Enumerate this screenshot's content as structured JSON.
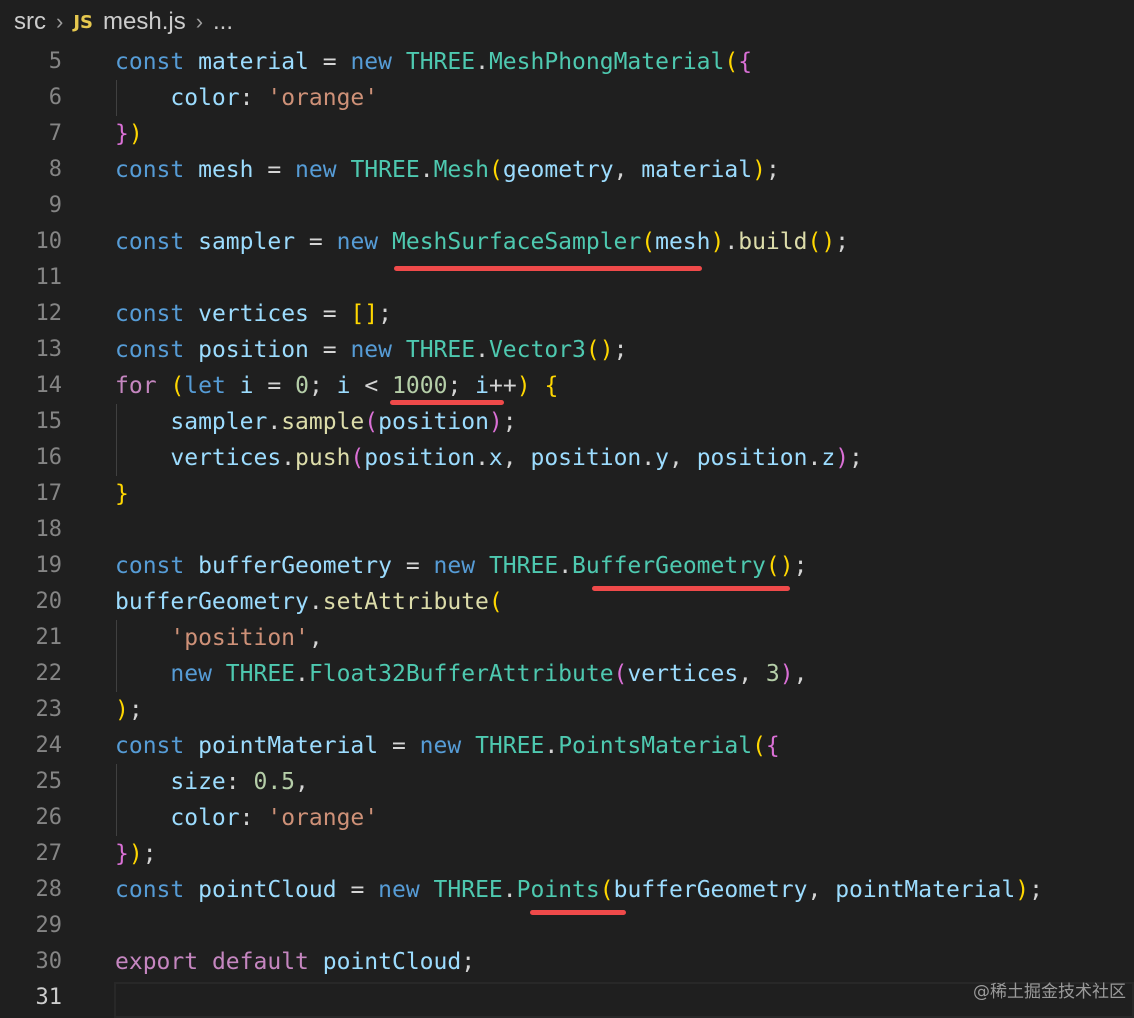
{
  "breadcrumb": {
    "folder": "src",
    "file_icon": "JS",
    "file": "mesh.js",
    "ellipsis": "..."
  },
  "colors": {
    "background": "#1f1f1f",
    "keyword": "#569cd6",
    "class": "#4ec9b0",
    "variable": "#9cdcfe",
    "string": "#ce9178",
    "number": "#b5cea8",
    "underline": "#ef4a4a"
  },
  "code": {
    "lines": [
      {
        "n": "5"
      },
      {
        "n": "6"
      },
      {
        "n": "7"
      },
      {
        "n": "8"
      },
      {
        "n": "9"
      },
      {
        "n": "10"
      },
      {
        "n": "11"
      },
      {
        "n": "12"
      },
      {
        "n": "13"
      },
      {
        "n": "14"
      },
      {
        "n": "15"
      },
      {
        "n": "16"
      },
      {
        "n": "17"
      },
      {
        "n": "18"
      },
      {
        "n": "19"
      },
      {
        "n": "20"
      },
      {
        "n": "21"
      },
      {
        "n": "22"
      },
      {
        "n": "23"
      },
      {
        "n": "24"
      },
      {
        "n": "25"
      },
      {
        "n": "26"
      },
      {
        "n": "27"
      },
      {
        "n": "28"
      },
      {
        "n": "29"
      },
      {
        "n": "30"
      },
      {
        "n": "31"
      }
    ],
    "tokens": {
      "const": "const",
      "new": "new",
      "for": "for",
      "let": "let",
      "export": "export",
      "default": "default",
      "three": "THREE",
      "dot": ".",
      "eq": " = ",
      "material": "material",
      "MeshPhongMaterial": "MeshPhongMaterial",
      "color": "color",
      "colon": ": ",
      "orange": "'orange'",
      "mesh": "mesh",
      "Mesh": "Mesh",
      "geometry": "geometry",
      "comma": ", ",
      "semi": ";",
      "sampler": "sampler",
      "MeshSurfaceSampler": "MeshSurfaceSampler",
      "build": "build",
      "vertices": "vertices",
      "position": "position",
      "Vector3": "Vector3",
      "i": "i",
      "zero": "0",
      "lt": " < ",
      "thousand": "1000",
      "inc": "++",
      "sample": "sample",
      "push": "push",
      "x": "x",
      "y": "y",
      "z": "z",
      "bufferGeometry": "bufferGeometry",
      "BufferGeometry": "BufferGeometry",
      "setAttribute": "setAttribute",
      "positionStr": "'position'",
      "Float32BufferAttribute": "Float32BufferAttribute",
      "three_num": "3",
      "pointMaterial": "pointMaterial",
      "PointsMaterial": "PointsMaterial",
      "size": "size",
      "half": "0.5",
      "pointCloud": "pointCloud",
      "Points": "Points"
    }
  },
  "watermark": "@稀土掘金技术社区"
}
